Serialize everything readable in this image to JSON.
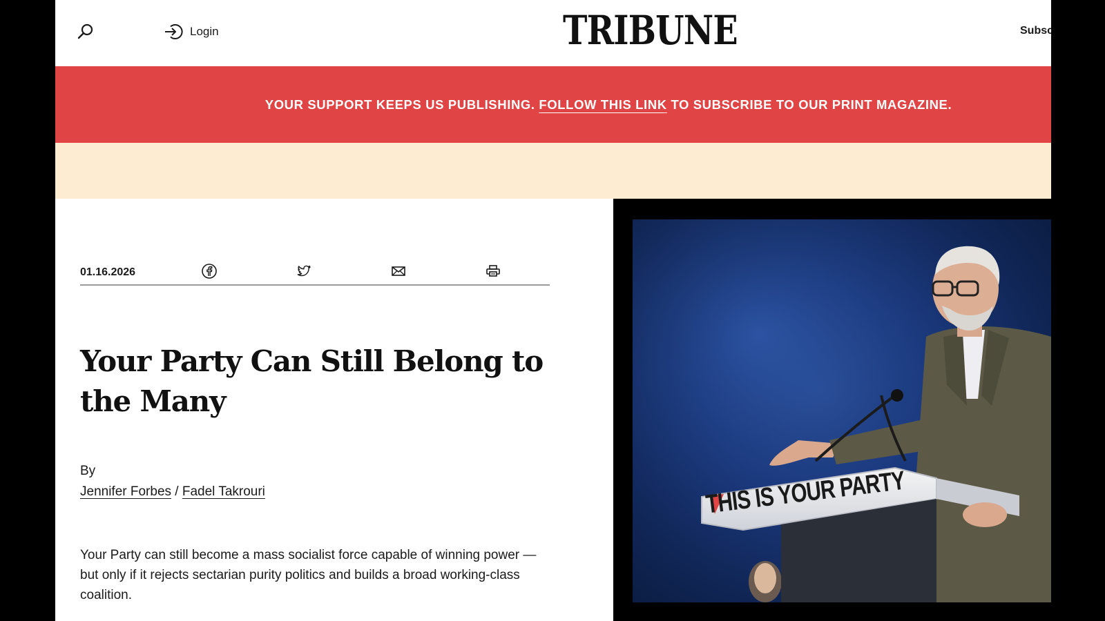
{
  "header": {
    "logo": "TRIBUNE",
    "login_label": "Login",
    "subscribe_label": "Subsc"
  },
  "banner": {
    "text_before": "YOUR SUPPORT KEEPS US PUBLISHING. ",
    "link_text": "FOLLOW THIS LINK",
    "text_after": " TO SUBSCRIBE TO OUR PRINT MAGAZINE."
  },
  "article": {
    "date": "01.16.2026",
    "share_icons": [
      "facebook-icon",
      "twitter-icon",
      "email-icon",
      "print-icon"
    ],
    "headline": "Your Party Can Still Belong to the Many",
    "by_label": "By",
    "authors": [
      "Jennifer Forbes",
      "Fadel Takrouri"
    ],
    "author_separator": " / ",
    "standfirst": "Your Party can still become a mass socialist force capable of winning power — but only if it rejects sectarian purity politics and builds a broad working-class coalition."
  },
  "photo": {
    "podium_sign": "THIS IS YOUR PARTY"
  },
  "colors": {
    "banner_red": "#e04444",
    "cream": "#fdecd2",
    "photo_blue": "#1b3a80"
  }
}
